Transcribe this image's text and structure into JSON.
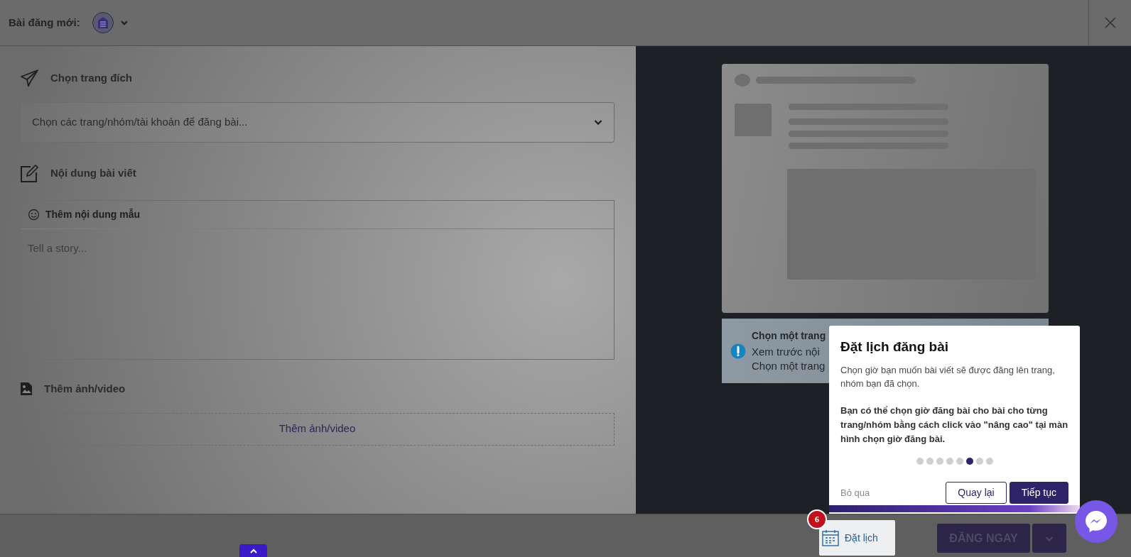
{
  "header": {
    "title": "Bài đăng mới:"
  },
  "target": {
    "title": "Chọn trang đích",
    "placeholder": "Chọn các trang/nhóm/tài khoản để đăng bài..."
  },
  "content": {
    "title": "Nội dung bài viết",
    "toolbar_label": "Thêm nội dung mẫu",
    "placeholder": "Tell a story..."
  },
  "media": {
    "title": "Thêm ảnh/video",
    "button": "Thêm ảnh/video"
  },
  "preview": {
    "alert_title": "Chọn một trang",
    "alert_lines": [
      "Xem trước nội",
      "Chọn một trang"
    ]
  },
  "tour": {
    "title": "Đặt lịch đăng bài",
    "description": "Chọn giờ bạn muốn bài viết sẽ được đăng lên trang, nhóm bạn đã chọn.",
    "note": "Bạn có thể chọn giờ đăng bài cho bài cho từng trang/nhóm bằng cách click vào \"nâng cao\" tại màn hình chọn giờ đăng bài.",
    "steps": [
      {
        "selected": false
      },
      {
        "selected": false
      },
      {
        "selected": false
      },
      {
        "selected": false
      },
      {
        "selected": false
      },
      {
        "selected": true
      },
      {
        "selected": false
      },
      {
        "selected": false
      }
    ],
    "skip": "Bỏ qua",
    "back": "Quay lại",
    "next": "Tiếp tục"
  },
  "footer": {
    "schedule_label": "Đặt lịch",
    "schedule_badge": "6",
    "publish": "ĐĂNG NGAY"
  }
}
